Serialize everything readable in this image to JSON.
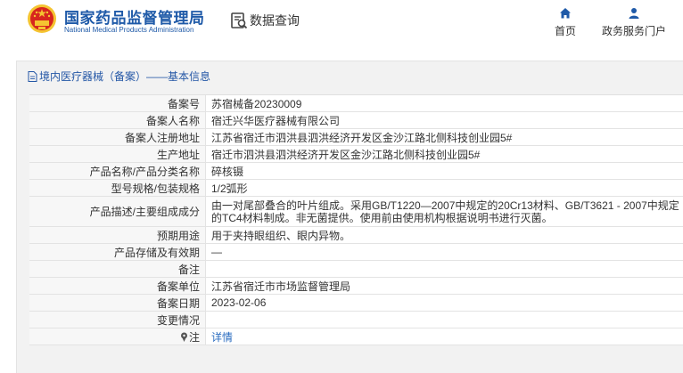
{
  "header": {
    "site_name_cn": "国家药品监督管理局",
    "site_name_en": "National Medical Products Administration",
    "data_query_label": "数据查询",
    "nav": {
      "home": "首页",
      "service": "政务服务门户"
    }
  },
  "panel": {
    "title": "境内医疗器械（备案）——基本信息"
  },
  "record": {
    "rows": [
      {
        "label": "备案号",
        "value": "苏宿械备20230009"
      },
      {
        "label": "备案人名称",
        "value": "宿迁兴华医疗器械有限公司"
      },
      {
        "label": "备案人注册地址",
        "value": "江苏省宿迁市泗洪县泗洪经济开发区金沙江路北侧科技创业园5#"
      },
      {
        "label": "生产地址",
        "value": "宿迁市泗洪县泗洪经济开发区金沙江路北侧科技创业园5#"
      },
      {
        "label": "产品名称/产品分类名称",
        "value": "碎核镊"
      },
      {
        "label": "型号规格/包装规格",
        "value": "1/2弧形"
      },
      {
        "label": "产品描述/主要组成成分",
        "value": "由一对尾部叠合的叶片组成。采用GB/T1220—2007中规定的20Cr13材料、GB/T3621 - 2007中规定的TC4材料制成。非无菌提供。使用前由使用机构根据说明书进行灭菌。"
      },
      {
        "label": "预期用途",
        "value": "用于夹持眼组织、眼内异物。"
      },
      {
        "label": "产品存储及有效期",
        "value": "—"
      },
      {
        "label": "备注",
        "value": ""
      },
      {
        "label": "备案单位",
        "value": "江苏省宿迁市市场监督管理局"
      },
      {
        "label": "备案日期",
        "value": "2023-02-06"
      },
      {
        "label": "变更情况",
        "value": ""
      },
      {
        "label": "注",
        "value": "详情"
      }
    ]
  },
  "colors": {
    "brand_blue": "#1f5aa8",
    "link_blue": "#2a6cc0",
    "emblem_red": "#d7261e",
    "emblem_gold": "#f5c431"
  },
  "icons": {
    "emblem": "national-emblem-icon",
    "data_query": "data-query-icon",
    "home": "home-icon",
    "service": "user-icon",
    "title": "document-icon",
    "note": "pin-icon"
  }
}
